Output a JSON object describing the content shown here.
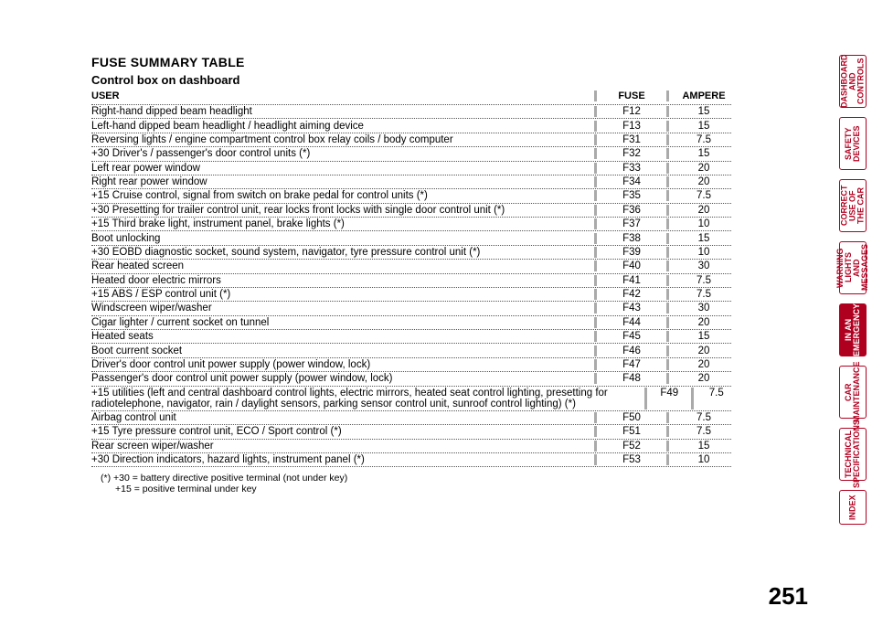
{
  "title": "FUSE SUMMARY TABLE",
  "subtitle": "Control box on dashboard",
  "columns": {
    "user": "USER",
    "fuse": "FUSE",
    "ampere": "AMPERE"
  },
  "rows": [
    {
      "user": "Right-hand dipped beam headlight",
      "fuse": "F12",
      "ampere": "15"
    },
    {
      "user": "Left-hand dipped beam headlight / headlight aiming device",
      "fuse": "F13",
      "ampere": "15"
    },
    {
      "user": "Reversing lights / engine compartment control box relay coils / body computer",
      "fuse": "F31",
      "ampere": "7.5"
    },
    {
      "user": "+30 Driver's / passenger's door control units (*)",
      "fuse": "F32",
      "ampere": "15"
    },
    {
      "user": "Left rear power window",
      "fuse": "F33",
      "ampere": "20"
    },
    {
      "user": "Right rear power window",
      "fuse": "F34",
      "ampere": "20"
    },
    {
      "user": "+15 Cruise control, signal from switch on brake pedal for control units (*)",
      "fuse": "F35",
      "ampere": "7.5"
    },
    {
      "user": "+30 Presetting for trailer control unit, rear locks front locks with single door control unit (*)",
      "fuse": "F36",
      "ampere": "20"
    },
    {
      "user": "+15 Third brake light, instrument panel, brake lights (*)",
      "fuse": "F37",
      "ampere": "10"
    },
    {
      "user": "Boot unlocking",
      "fuse": "F38",
      "ampere": "15"
    },
    {
      "user": "+30 EOBD diagnostic socket, sound system, navigator, tyre pressure control unit (*)",
      "fuse": "F39",
      "ampere": "10"
    },
    {
      "user": "Rear heated screen",
      "fuse": "F40",
      "ampere": "30"
    },
    {
      "user": "Heated door electric mirrors",
      "fuse": "F41",
      "ampere": "7.5"
    },
    {
      "user": "+15 ABS / ESP control unit (*)",
      "fuse": "F42",
      "ampere": "7.5"
    },
    {
      "user": "Windscreen wiper/washer",
      "fuse": "F43",
      "ampere": "30"
    },
    {
      "user": "Cigar lighter / current socket on tunnel",
      "fuse": "F44",
      "ampere": "20"
    },
    {
      "user": "Heated seats",
      "fuse": "F45",
      "ampere": "15"
    },
    {
      "user": "Boot current socket",
      "fuse": "F46",
      "ampere": "20"
    },
    {
      "user": "Driver's door control unit power supply (power window, lock)",
      "fuse": "F47",
      "ampere": "20"
    },
    {
      "user": "Passenger's door control unit power supply (power window, lock)",
      "fuse": "F48",
      "ampere": "20"
    },
    {
      "user": "+15 utilities (left and central dashboard control lights, electric mirrors, heated seat control lighting, presetting for radiotelephone, navigator, rain / daylight sensors, parking sensor control unit, sunroof control lighting) (*)",
      "fuse": "F49",
      "ampere": "7.5"
    },
    {
      "user": "Airbag control unit",
      "fuse": "F50",
      "ampere": "7.5"
    },
    {
      "user": "+15 Tyre pressure control unit, ECO / Sport control (*)",
      "fuse": "F51",
      "ampere": "7.5"
    },
    {
      "user": "Rear screen wiper/washer",
      "fuse": "F52",
      "ampere": "15"
    },
    {
      "user": "+30 Direction indicators, hazard lights, instrument panel (*)",
      "fuse": "F53",
      "ampere": "10"
    }
  ],
  "footnote1": "(*) +30 = battery directive positive terminal (not under key)",
  "footnote2": "+15 = positive terminal under key",
  "page_number": "251",
  "tabs": [
    {
      "label": "DASHBOARD AND CONTROLS",
      "active": false
    },
    {
      "label": "SAFETY DEVICES",
      "active": false
    },
    {
      "label": "CORRECT USE OF THE CAR",
      "active": false
    },
    {
      "label": "WARNING LIGHTS AND MESSAGES",
      "active": false
    },
    {
      "label": "IN AN EMERGENCY",
      "active": true
    },
    {
      "label": "CAR MAINTENANCE",
      "active": false
    },
    {
      "label": "TECHNICAL SPECIFICATIONS",
      "active": false
    },
    {
      "label": "INDEX",
      "active": false,
      "small": true
    }
  ]
}
